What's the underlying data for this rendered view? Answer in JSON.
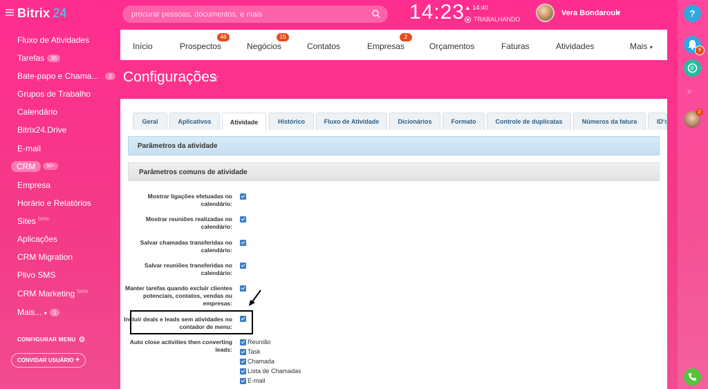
{
  "app": {
    "logo_name": "Bitrix",
    "logo_num": "24",
    "search_placeholder": "procurar pessoas, documentos, e mais",
    "clock": "14:23",
    "alarm": "14:40",
    "status": "TRABALHANDO",
    "user_name": "Vera Bondarouk"
  },
  "sidebar": {
    "items": [
      {
        "label": "Fluxo de Atividades"
      },
      {
        "label": "Tarefas",
        "badge": "36"
      },
      {
        "label": "Bate-papo e Chama...",
        "badge": "2"
      },
      {
        "label": "Grupos de Trabalho"
      },
      {
        "label": "Calendário"
      },
      {
        "label": "Bitrix24.Drive"
      },
      {
        "label": "E-mail"
      },
      {
        "label": "Empresa"
      },
      {
        "label": "Horário e Relatórios"
      },
      {
        "label": "Sites",
        "sup": "beta"
      },
      {
        "label": "Aplicações"
      },
      {
        "label": "CRM Migration"
      },
      {
        "label": "Plivo SMS"
      },
      {
        "label": "CRM Marketing",
        "sup": "beta"
      },
      {
        "label": "Mais...",
        "badge": "1"
      }
    ],
    "active_label": "CRM",
    "active_badge": "50+",
    "config_menu": "CONFIGURAR MENU",
    "invite": "CONVIDAR USUÁRIO"
  },
  "topnav": {
    "items": [
      {
        "label": "Início"
      },
      {
        "label": "Prospectos",
        "badge": "48"
      },
      {
        "label": "Negócios",
        "badge": "15"
      },
      {
        "label": "Contatos"
      },
      {
        "label": "Empresas",
        "badge": "2"
      },
      {
        "label": "Orçamentos"
      },
      {
        "label": "Faturas"
      },
      {
        "label": "Atividades"
      },
      {
        "label": "Mais"
      }
    ]
  },
  "page_title": "Configurações",
  "subtabs": [
    "Geral",
    "Aplicativos",
    "Atividade",
    "Histórico",
    "Fluxo de Atividade",
    "Dicionários",
    "Formato",
    "Controle de duplicatas",
    "Números da fatura",
    "ID's"
  ],
  "active_subtab": "Atividade",
  "sections": {
    "activity_params": "Parâmetros da atividade",
    "common_params": "Parâmetros comuns de atividade"
  },
  "options": [
    {
      "label": "Mostrar ligações efetuadas no calendário:",
      "checked": true
    },
    {
      "label": "Mostrar reuniões realizadas no calendário:",
      "checked": true
    },
    {
      "label": "Salvar chamadas transferidas no calendário:",
      "checked": true
    },
    {
      "label": "Salvar reuniões transferidas no calendário:",
      "checked": true
    },
    {
      "label": "Manter tarefas quando excluir clientes potenciais, contatos, vendas ou empresas:",
      "checked": true
    },
    {
      "label": "Incluir deals e leads sem atividades no contador de menu:",
      "checked": true
    },
    {
      "label": "Auto close activities then converting leads:",
      "checked": true
    }
  ],
  "auto_close_types": [
    "Reunião",
    "Task",
    "Chamada",
    "Lista de Chamadas",
    "E-mail"
  ],
  "help_label": "?",
  "bell_count": "9",
  "rb_avatar_count": "2"
}
